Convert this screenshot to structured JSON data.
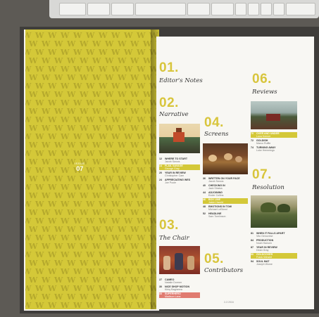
{
  "cover": {
    "issue_label": "ISSUE",
    "issue_number": "07",
    "pattern_letter": "W"
  },
  "colors": {
    "accent_yellow": "#d4c838",
    "highlight_pink": "#e07b70",
    "paper": "#f8f7f3"
  },
  "sections": {
    "s01": {
      "number": "01.",
      "title": "Editor's Notes"
    },
    "s02": {
      "number": "02.",
      "title": "Narrative"
    },
    "s03": {
      "number": "03.",
      "title": "The Chair"
    },
    "s04": {
      "number": "04.",
      "title": "Screens"
    },
    "s05": {
      "number": "05.",
      "title": "Contributors"
    },
    "s06": {
      "number": "06.",
      "title": "Reviews"
    },
    "s07": {
      "number": "07.",
      "title": "Resolution"
    }
  },
  "narrative_entries": [
    {
      "num": "12",
      "title": "WHERE TO START",
      "author": "Jacob Swoos",
      "highlight": "none"
    },
    {
      "num": "14",
      "title": "FLAIL SAVAGE",
      "author": "George Gray",
      "highlight": "yellow"
    },
    {
      "num": "20",
      "title": "YEAR IN REVIEW",
      "author": "Christopher Cam",
      "highlight": "none"
    },
    {
      "num": "24",
      "title": "APPRECIATING WES",
      "author": "Joe Poole",
      "highlight": "none"
    }
  ],
  "chair_entries": [
    {
      "num": "27",
      "title": "CAMEO",
      "author": "Natalie Dormer",
      "highlight": "none"
    },
    {
      "num": "30",
      "title": "NICE SHOP MOTION",
      "author": "Kirby Bagheera",
      "highlight": "none"
    },
    {
      "num": "33",
      "title": "SUPERHERO",
      "author": "Madison Lane",
      "highlight": "pink"
    }
  ],
  "screens_entries": [
    {
      "num": "36",
      "title": "WRITTEN ON YOUR FACE",
      "author": "Jacob Swoos",
      "highlight": "none"
    },
    {
      "num": "40",
      "title": "CHECKING IN",
      "author": "Jack Stratus",
      "highlight": "none"
    },
    {
      "num": "44",
      "title": "ADJOINING",
      "author": "Ender Collins",
      "highlight": "none"
    },
    {
      "num": "46",
      "title": "BOX LINE",
      "author": "Jakim Harold",
      "highlight": "yellow"
    },
    {
      "num": "48",
      "title": "EMOTIONS IN TOW",
      "author": "Michael LeBlond",
      "highlight": "none"
    },
    {
      "num": "52",
      "title": "HEADLINE",
      "author": "Sam Tomlinson",
      "highlight": "none"
    }
  ],
  "reviews_entries": [
    {
      "num": "70",
      "title": "OVER AND UNDER",
      "author": "Luca Keener",
      "highlight": "yellow"
    },
    {
      "num": "72",
      "title": "GOLDISH",
      "author": "Marco Ruffle",
      "highlight": "none"
    },
    {
      "num": "74",
      "title": "TURNING AWAY",
      "author": "Luke Hemmings",
      "highlight": "none"
    }
  ],
  "resolution_entries": [
    {
      "num": "81",
      "title": "WHEN IT FALLS APART",
      "author": "Vito Genovese",
      "highlight": "none"
    },
    {
      "num": "84",
      "title": "PRODUCTION",
      "author": "Noah Hansen",
      "highlight": "none"
    },
    {
      "num": "87",
      "title": "YEAR IN REVIEW",
      "author": "Dean Gray",
      "highlight": "none"
    },
    {
      "num": "90",
      "title": "GOLDCOVER",
      "author": "Frank Winslet",
      "highlight": "yellow"
    },
    {
      "num": "94",
      "title": "SOUL MAT",
      "author": "Joseph Wome",
      "highlight": "none"
    }
  ],
  "footer": {
    "page_number": "2-3 2016"
  }
}
